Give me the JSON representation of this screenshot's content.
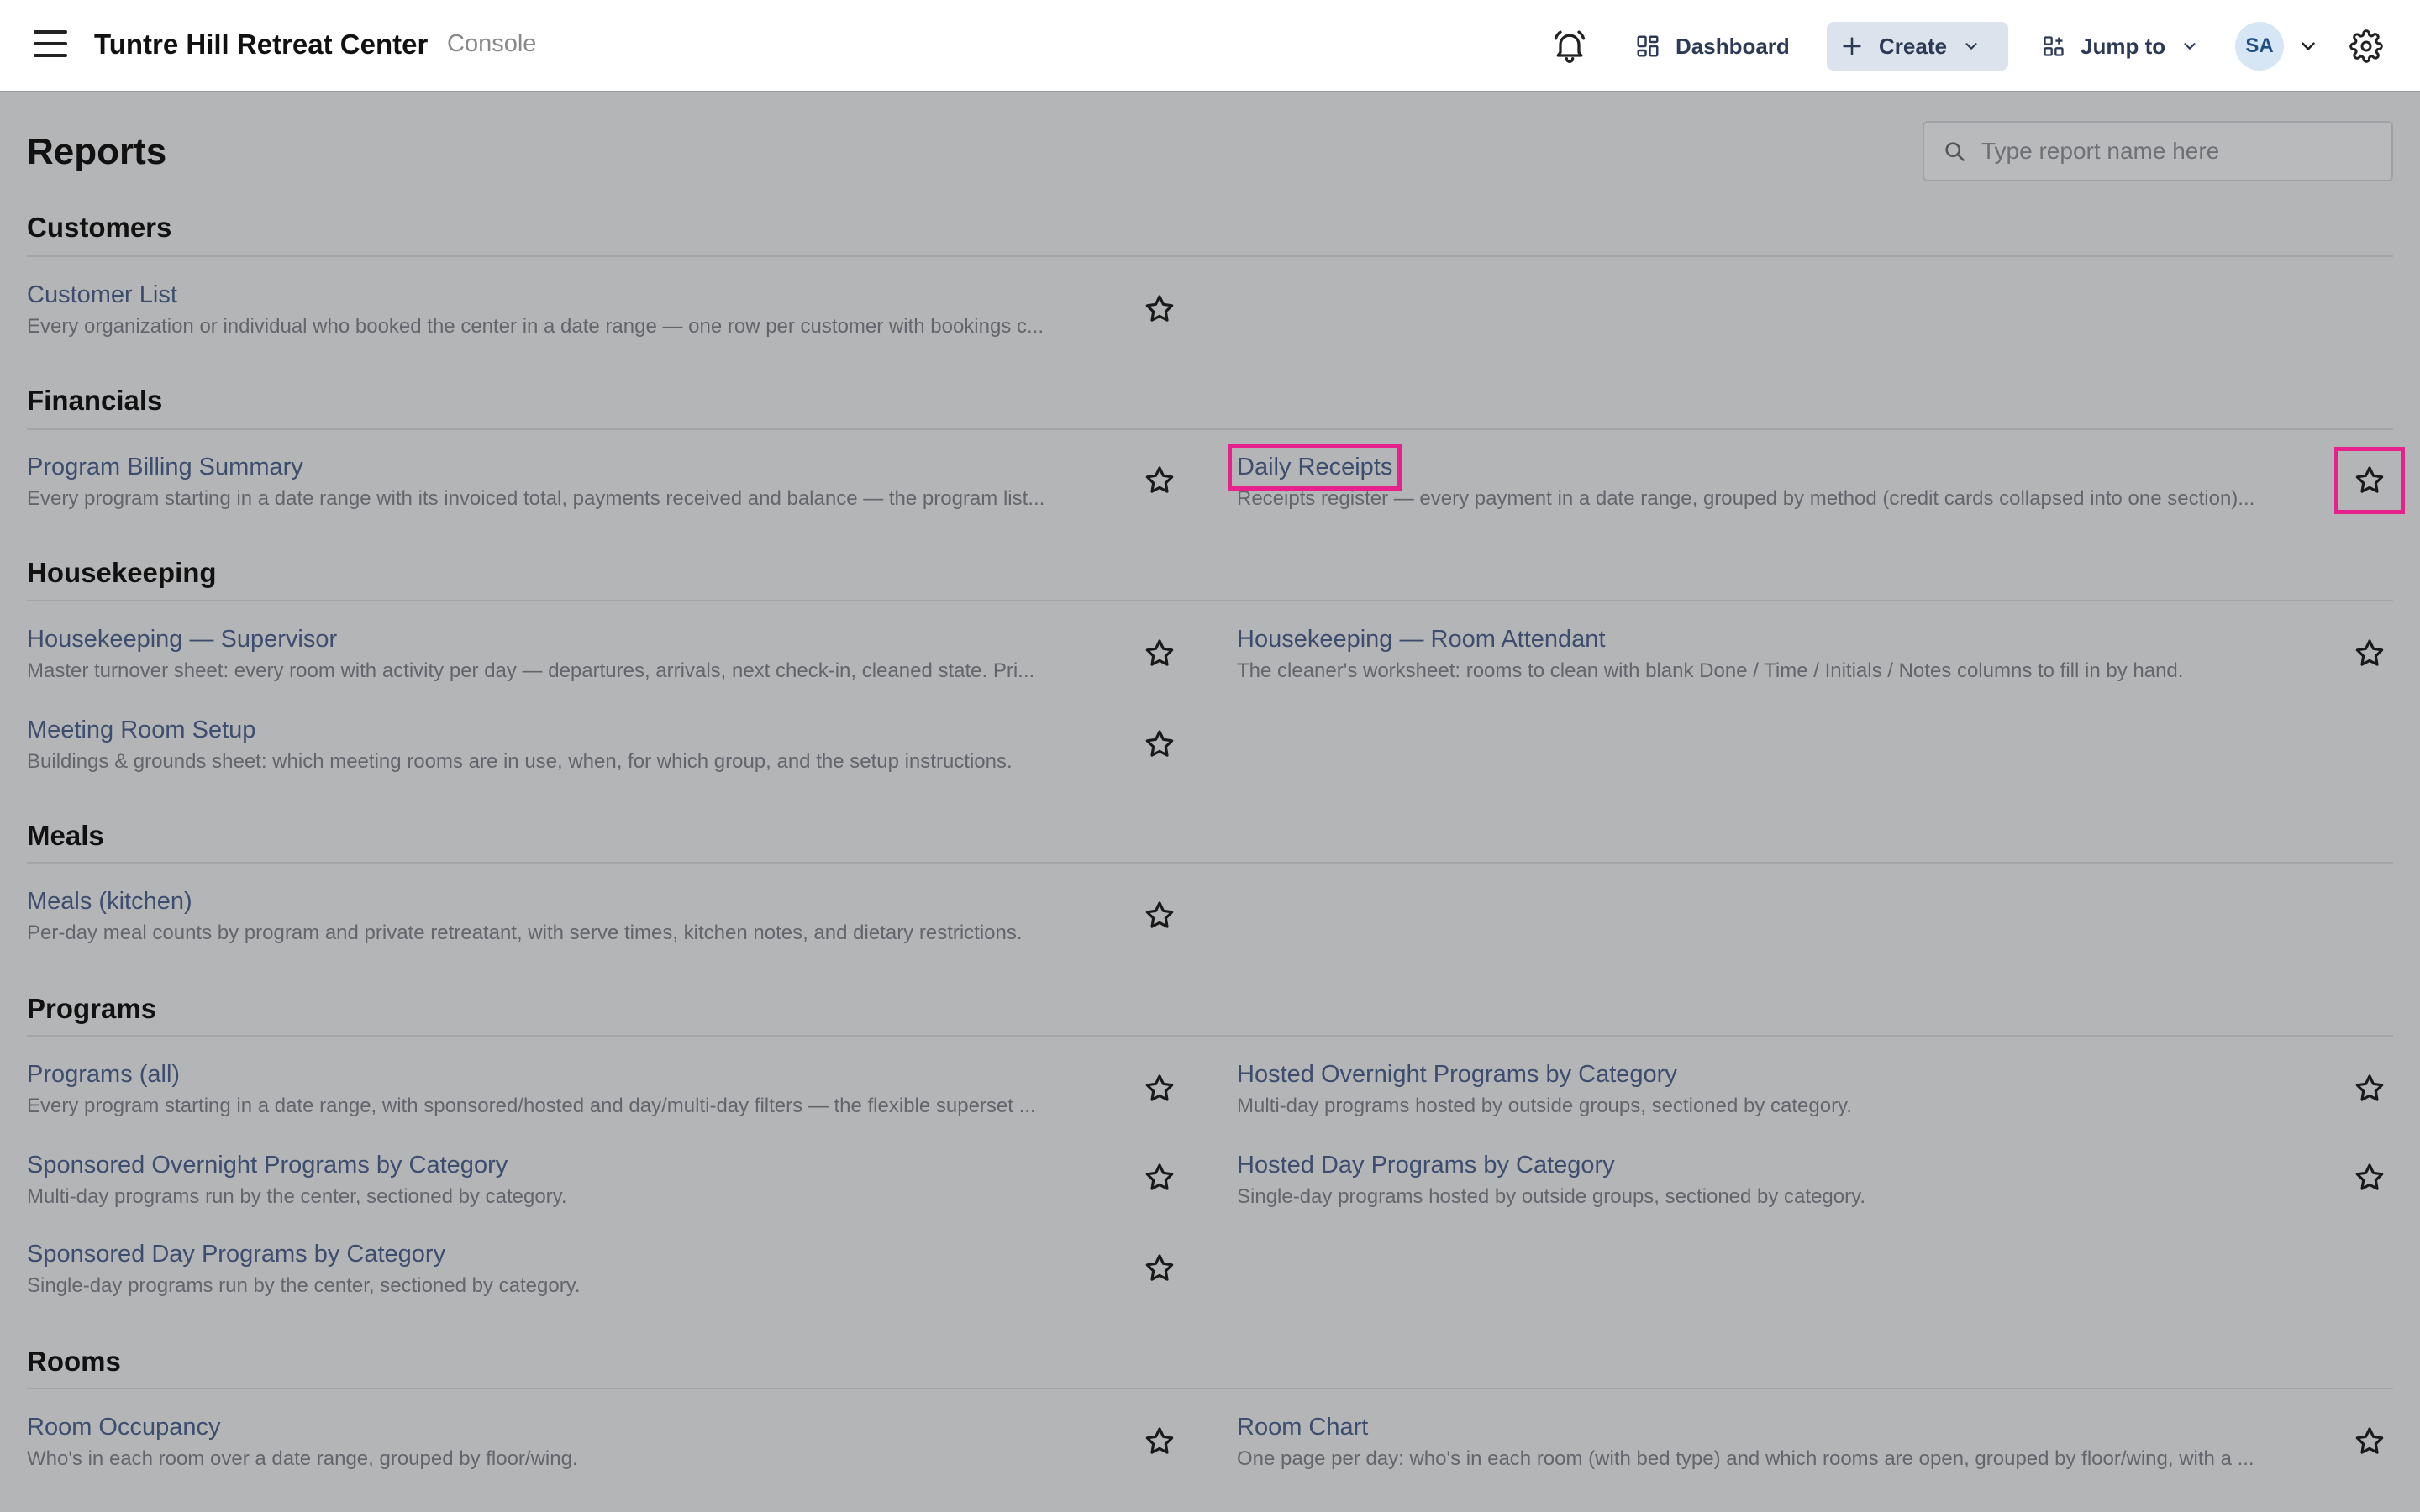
{
  "header": {
    "app_title": "Tuntre Hill Retreat Center",
    "app_subtitle": "Console",
    "dashboard_label": "Dashboard",
    "create_label": "Create",
    "jump_label": "Jump to",
    "avatar_initials": "SA"
  },
  "page": {
    "title": "Reports",
    "search_placeholder": "Type report name here"
  },
  "sections": {
    "customers": {
      "title": "Customers",
      "reports": [
        {
          "name": "Customer List",
          "desc": "Every organization or individual who booked the center in a date range — one row per customer with bookings c..."
        }
      ]
    },
    "financials": {
      "title": "Financials",
      "reports": [
        {
          "name": "Program Billing Summary",
          "desc": "Every program starting in a date range with its invoiced total, payments received and balance — the program list..."
        },
        {
          "name": "Daily Receipts",
          "desc": "Receipts register — every payment in a date range, grouped by method (credit cards collapsed into one section)..."
        }
      ]
    },
    "housekeeping": {
      "title": "Housekeeping",
      "reports": [
        {
          "name": "Housekeeping — Supervisor",
          "desc": "Master turnover sheet: every room with activity per day — departures, arrivals, next check-in, cleaned state. Pri..."
        },
        {
          "name": "Housekeeping — Room Attendant",
          "desc": "The cleaner's worksheet: rooms to clean with blank Done / Time / Initials / Notes columns to fill in by hand."
        },
        {
          "name": "Meeting Room Setup",
          "desc": "Buildings & grounds sheet: which meeting rooms are in use, when, for which group, and the setup instructions."
        }
      ]
    },
    "meals": {
      "title": "Meals",
      "reports": [
        {
          "name": "Meals (kitchen)",
          "desc": "Per-day meal counts by program and private retreatant, with serve times, kitchen notes, and dietary restrictions."
        }
      ]
    },
    "programs": {
      "title": "Programs",
      "reports": [
        {
          "name": "Programs (all)",
          "desc": "Every program starting in a date range, with sponsored/hosted and day/multi-day filters — the flexible superset ..."
        },
        {
          "name": "Hosted Overnight Programs by Category",
          "desc": "Multi-day programs hosted by outside groups, sectioned by category."
        },
        {
          "name": "Sponsored Overnight Programs by Category",
          "desc": "Multi-day programs run by the center, sectioned by category."
        },
        {
          "name": "Hosted Day Programs by Category",
          "desc": "Single-day programs hosted by outside groups, sectioned by category."
        },
        {
          "name": "Sponsored Day Programs by Category",
          "desc": "Single-day programs run by the center, sectioned by category."
        }
      ]
    },
    "rooms": {
      "title": "Rooms",
      "reports": [
        {
          "name": "Room Occupancy",
          "desc": "Who's in each room over a date range, grouped by floor/wing."
        },
        {
          "name": "Room Chart",
          "desc": "One page per day: who's in each room (with bed type) and which rooms are open, grouped by floor/wing, with a ..."
        }
      ]
    }
  },
  "colors": {
    "highlight": "#e6218b",
    "link": "#3d4d6e",
    "overlay_bg": "#b4b5b7"
  }
}
